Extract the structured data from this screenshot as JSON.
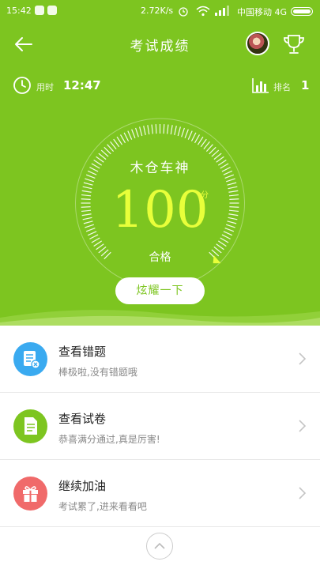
{
  "status_bar": {
    "time": "15:42",
    "speed": "2.72K/s",
    "carrier": "中国移动 4G"
  },
  "header": {
    "title": "考试成绩"
  },
  "stats": {
    "time_label": "用时",
    "time_value": "12:47",
    "rank_label": "排名",
    "rank_value": "1"
  },
  "result": {
    "name": "木仓车神",
    "score": "100",
    "unit": "分",
    "status": "合格",
    "share_label": "炫耀一下",
    "gauge_level": 1.0
  },
  "list": [
    {
      "title": "查看错题",
      "subtitle": "棒极啦,没有错题哦",
      "icon": "wrong-questions-icon",
      "color": "#3aaaf0"
    },
    {
      "title": "查看试卷",
      "subtitle": "恭喜满分通过,真是厉害!",
      "icon": "exam-paper-icon",
      "color": "#7dc520"
    },
    {
      "title": "继续加油",
      "subtitle": "考试累了,进来看看吧",
      "icon": "gift-icon",
      "color": "#f06a6a"
    }
  ],
  "colors": {
    "primary": "#7dc520",
    "score": "#e8ff3a"
  }
}
